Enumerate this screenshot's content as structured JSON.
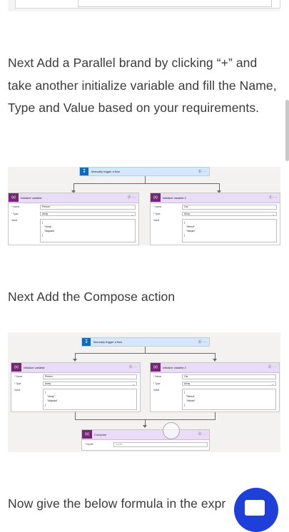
{
  "paragraphs": {
    "p1": "Next Add a Parallel brand by clicking “+” and take another initialize variable and fill the Name, Type and Value based on your requirements.",
    "p2": "Next Add the Compose action",
    "p3": "Now give the below formula in the expr"
  },
  "diagram": {
    "trigger_label": "Manually trigger a flow",
    "trigger_menu": "⓪ ···",
    "node1": {
      "title": "Initialize variable",
      "menu": "⓪ ···",
      "name_label": "* Name",
      "name_value": "Person",
      "type_label": "* Type",
      "type_value": "Array",
      "value_label": "Value",
      "value_lines": [
        "[",
        "\"Vinay\",",
        "\"Alapaka\"",
        "]"
      ]
    },
    "node2": {
      "title": "Initialize variable 2",
      "menu": "⓪ ···",
      "name_label": "* Name",
      "name_value": "Car",
      "type_label": "* Type",
      "type_value": "Array",
      "value_label": "Value",
      "value_lines": [
        "[",
        "\"Mercd\",",
        "\"Nissan\"",
        "]"
      ]
    },
    "compose": {
      "title": "Compose",
      "menu": "⓪ ···",
      "inputs_label": "* Inputs",
      "inputs_placeholder": "Inputs"
    },
    "icon_var": "{x}",
    "chevron": "⌄"
  },
  "colors": {
    "accent": "#1e40d8",
    "trigger": "#0f6cbd",
    "variable": "#742774"
  }
}
